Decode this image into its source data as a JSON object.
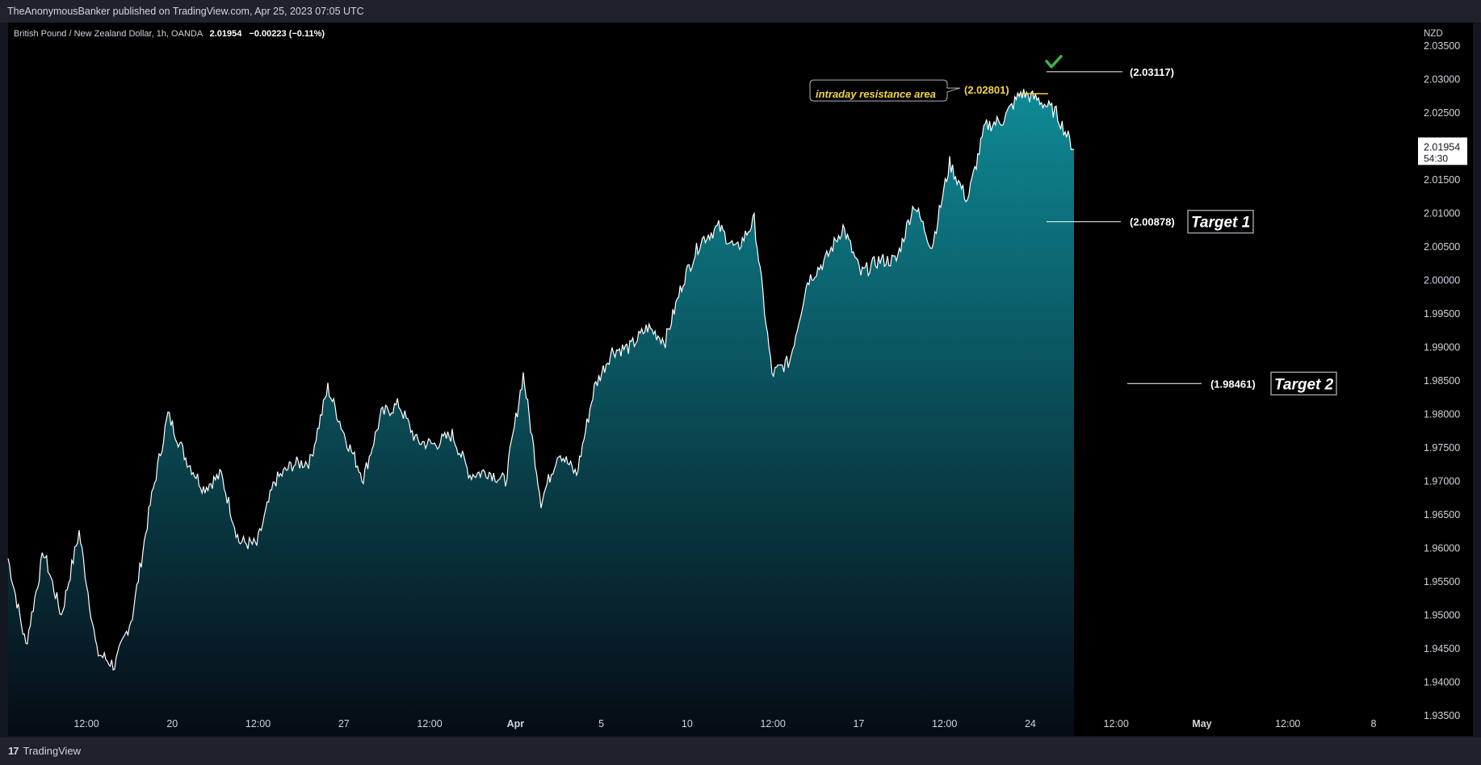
{
  "header": {
    "published": "TheAnonymousBanker published on TradingView.com, Apr 25, 2023 07:05 UTC"
  },
  "legend": {
    "symbol": "British Pound / New Zealand Dollar, 1h, OANDA",
    "last": "2.01954",
    "change": "−0.00223 (−0.11%)"
  },
  "footer": {
    "logo_text": "TradingView",
    "logo_mark": "17"
  },
  "colors": {
    "background": "#000000",
    "line": "#ffffff",
    "area_top": "#0e8a96",
    "area_bottom": "#060b14",
    "resistance": "#f5d547",
    "check": "#3fb34f"
  },
  "chart_data": {
    "type": "area",
    "title": "British Pound / New Zealand Dollar, 1h, OANDA",
    "currency": "NZD",
    "ylim": [
      1.932,
      2.0385
    ],
    "yticks": [
      "2.03500",
      "2.03000",
      "2.02500",
      "2.02000",
      "2.01500",
      "2.01000",
      "2.00500",
      "2.00000",
      "1.99500",
      "1.99000",
      "1.98500",
      "1.98000",
      "1.97500",
      "1.97000",
      "1.96500",
      "1.96000",
      "1.95500",
      "1.95000",
      "1.94500",
      "1.94000",
      "1.93500"
    ],
    "xticks": [
      "12:00",
      "20",
      "12:00",
      "27",
      "12:00",
      "Apr",
      "5",
      "10",
      "12:00",
      "17",
      "12:00",
      "24",
      "12:00",
      "May",
      "12:00",
      "8"
    ],
    "current_price": {
      "value": 2.01954,
      "label": "2.01954",
      "countdown": "54:30"
    },
    "series": [
      {
        "x": [
          "Mar 16 02:00",
          "Mar 16 12:00",
          "Mar 17 00:00",
          "Mar 17 12:00",
          "Mar 19 22:00",
          "Mar 20 04:00",
          "Mar 20 12:00",
          "Mar 21 00:00",
          "Mar 21 12:00",
          "Mar 22 00:00",
          "Mar 22 12:00",
          "Mar 23 00:00",
          "Mar 23 12:00",
          "Mar 24 00:00",
          "Mar 24 12:00",
          "Mar 27 00:00",
          "Mar 27 12:00",
          "Mar 28 00:00",
          "Mar 28 12:00",
          "Mar 29 00:00",
          "Mar 29 12:00",
          "Mar 30 00:00",
          "Mar 30 12:00",
          "Mar 31 00:00",
          "Mar 31 12:00",
          "Apr 3 00:00",
          "Apr 3 12:00",
          "Apr 4 00:00",
          "Apr 4 12:00",
          "Apr 5 00:00",
          "Apr 5 12:00",
          "Apr 6 00:00",
          "Apr 6 12:00",
          "Apr 7 00:00",
          "Apr 10 00:00",
          "Apr 10 12:00",
          "Apr 11 00:00",
          "Apr 11 12:00",
          "Apr 12 00:00",
          "Apr 12 12:00",
          "Apr 13 00:00",
          "Apr 13 12:00",
          "Apr 14 00:00",
          "Apr 14 12:00",
          "Apr 16 22:00",
          "Apr 17 00:00",
          "Apr 17 12:00",
          "Apr 18 00:00",
          "Apr 18 12:00",
          "Apr 19 00:00",
          "Apr 19 12:00",
          "Apr 20 00:00",
          "Apr 20 12:00",
          "Apr 21 00:00",
          "Apr 21 12:00",
          "Apr 23 22:00",
          "Apr 24 00:00",
          "Apr 24 12:00",
          "Apr 25 00:00",
          "Apr 25 06:00",
          "Apr 25 07:00"
        ],
        "values": [
          1.9585,
          1.9455,
          1.9595,
          1.95,
          1.9625,
          1.9445,
          1.9425,
          1.95,
          1.9665,
          1.98,
          1.9735,
          1.969,
          1.971,
          1.961,
          1.9605,
          1.97,
          1.9725,
          1.973,
          1.984,
          1.9765,
          1.9705,
          1.98,
          1.9815,
          1.976,
          1.9755,
          1.977,
          1.971,
          1.9715,
          1.97,
          1.986,
          1.967,
          1.9745,
          1.971,
          1.984,
          1.9895,
          1.99,
          1.993,
          1.991,
          2.0,
          2.006,
          2.008,
          2.0045,
          2.009,
          1.986,
          1.988,
          2.0,
          2.003,
          2.008,
          2.001,
          2.003,
          2.003,
          2.0115,
          2.005,
          2.0175,
          2.012,
          2.023,
          2.024,
          2.028,
          2.027,
          2.025,
          2.01954
        ]
      }
    ],
    "annotations": [
      {
        "label": "intraday resistance area",
        "value_label": "(2.02801)",
        "value": 2.02801
      },
      {
        "label": "",
        "value_label": "(2.03117)",
        "value": 2.03117
      },
      {
        "label": "Target 1",
        "value_label": "(2.00878)",
        "value": 2.00878
      },
      {
        "label": "Target 2",
        "value_label": "(1.98461)",
        "value": 1.98461
      }
    ]
  }
}
